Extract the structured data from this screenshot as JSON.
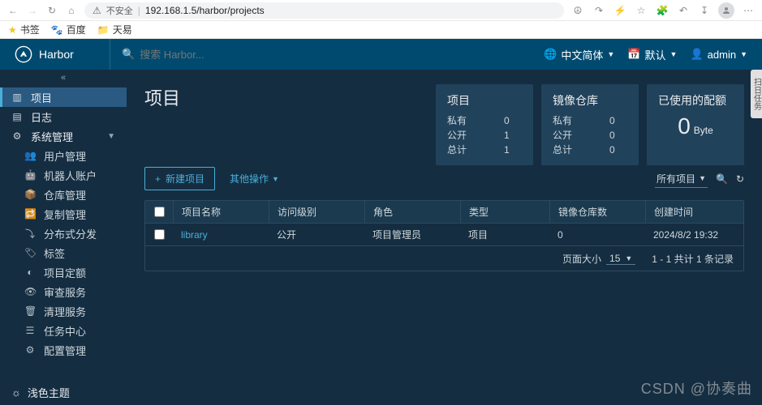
{
  "browser": {
    "insecure": "不安全",
    "url": "192.168.1.5/harbor/projects",
    "bookmarks": {
      "b1": "书签",
      "b2": "百度",
      "b3": "天易"
    }
  },
  "header": {
    "brand": "Harbor",
    "search_placeholder": "搜索 Harbor...",
    "lang": "中文简体",
    "event": "默认",
    "user": "admin"
  },
  "sidebar": {
    "projects": "项目",
    "logs": "日志",
    "sysmgmt": "系统管理",
    "users": "用户管理",
    "robots": "机器人账户",
    "repos": "仓库管理",
    "replication": "复制管理",
    "distribution": "分布式分发",
    "labels": "标签",
    "quota": "项目定额",
    "audit": "审查服务",
    "cleanup": "清理服务",
    "tasks": "任务中心",
    "config": "配置管理",
    "theme": "浅色主题"
  },
  "page": {
    "title": "项目",
    "cards": {
      "projects": {
        "title": "项目",
        "private_lbl": "私有",
        "private_val": "0",
        "public_lbl": "公开",
        "public_val": "1",
        "total_lbl": "总计",
        "total_val": "1"
      },
      "repos": {
        "title": "镜像仓库",
        "private_lbl": "私有",
        "private_val": "0",
        "public_lbl": "公开",
        "public_val": "0",
        "total_lbl": "总计",
        "total_val": "0"
      },
      "quota": {
        "title": "已使用的配额",
        "value": "0",
        "unit": "Byte"
      }
    },
    "toolbar": {
      "new": "新建项目",
      "other": "其他操作",
      "filter": "所有项目"
    },
    "table": {
      "cols": {
        "name": "项目名称",
        "access": "访问级别",
        "role": "角色",
        "type": "类型",
        "repo": "镜像仓库数",
        "time": "创建时间"
      },
      "row": {
        "name": "library",
        "access": "公开",
        "role": "项目管理员",
        "type": "项目",
        "repo": "0",
        "time": "2024/8/2 19:32"
      },
      "footer": {
        "pagesize_lbl": "页面大小",
        "pagesize_val": "15",
        "summary": "1 - 1 共计 1 条记录"
      }
    }
  },
  "right_tab": "扫日任务",
  "watermark": "CSDN @协奏曲"
}
